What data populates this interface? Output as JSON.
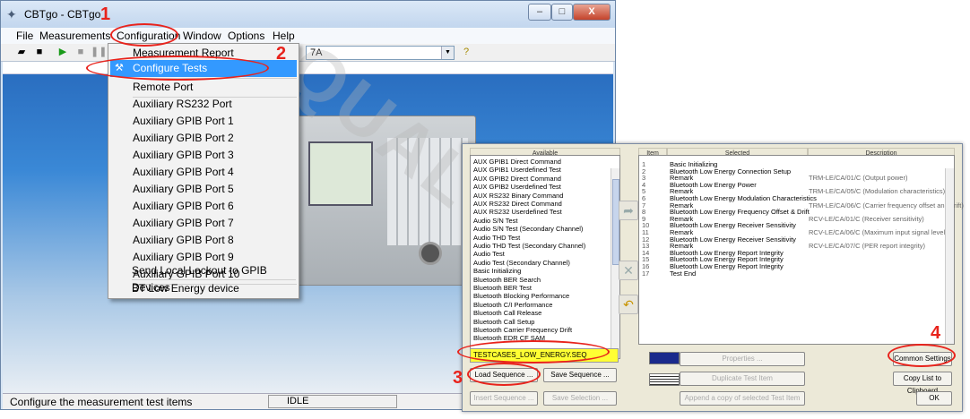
{
  "window": {
    "title": "CBTgo - CBTgo",
    "min": "–",
    "max": "□",
    "close": "X"
  },
  "menubar": [
    "File",
    "Measurements",
    "Configuration",
    "Window",
    "Options",
    "Help"
  ],
  "toolbar": {
    "combo_value": "7A"
  },
  "config_menu": {
    "items": [
      {
        "label": "Measurement Report"
      },
      {
        "label": "Configure Tests"
      },
      {
        "label": "Remote Port"
      },
      {
        "label": "Auxiliary RS232 Port"
      },
      {
        "label": "Auxiliary GPIB Port 1"
      },
      {
        "label": "Auxiliary GPIB Port 2"
      },
      {
        "label": "Auxiliary GPIB Port 3"
      },
      {
        "label": "Auxiliary GPIB Port 4"
      },
      {
        "label": "Auxiliary GPIB Port 5"
      },
      {
        "label": "Auxiliary GPIB Port 6"
      },
      {
        "label": "Auxiliary GPIB Port 7"
      },
      {
        "label": "Auxiliary GPIB Port 8"
      },
      {
        "label": "Auxiliary GPIB Port 9"
      },
      {
        "label": "Auxiliary GPIB Port 10"
      },
      {
        "label": "Send Local Lockout to GPIB Devices"
      },
      {
        "label": "BT Low Energy device"
      }
    ]
  },
  "statusbar": {
    "text": "Configure the measurement test items",
    "state": "IDLE"
  },
  "dialog": {
    "available_header": "Available",
    "available": [
      "AUX GPIB1 Direct Command",
      "AUX GPIB1 Userdefined Test",
      "AUX GPIB2 Direct Command",
      "AUX GPIB2 Userdefined Test",
      "AUX RS232 Binary Command",
      "AUX RS232 Direct Command",
      "AUX RS232 Userdefined Test",
      "Audio S/N Test",
      "Audio S/N Test (Secondary Channel)",
      "Audio THD Test",
      "Audio THD Test (Secondary Channel)",
      "Audio Test",
      "Audio Test (Secondary Channel)",
      "Basic Initializing",
      "Bluetooth BER Search",
      "Bluetooth BER Test",
      "Bluetooth Blocking Performance",
      "Bluetooth C/I Performance",
      "Bluetooth Call Release",
      "Bluetooth Call Setup",
      "Bluetooth Carrier Frequency Drift",
      "Bluetooth EDR CF SAM"
    ],
    "sequence_file": "TESTCASES_LOW_ENERGY.SEQ",
    "columns": {
      "item": "Item",
      "selected": "Selected",
      "description": "Description"
    },
    "rows": [
      {
        "n": "1",
        "name": "Basic Initializing",
        "desc": ""
      },
      {
        "n": "2",
        "name": "Bluetooth Low Energy Connection Setup",
        "desc": ""
      },
      {
        "n": "3",
        "name": "Remark",
        "desc": "TRM-LE/CA/01/C (Output power)"
      },
      {
        "n": "4",
        "name": "Bluetooth Low Energy Power",
        "desc": ""
      },
      {
        "n": "5",
        "name": "Remark",
        "desc": "TRM-LE/CA/05/C (Modulation characteristics)"
      },
      {
        "n": "6",
        "name": "Bluetooth Low Energy Modulation Characteristics",
        "desc": ""
      },
      {
        "n": "7",
        "name": "Remark",
        "desc": "TRM-LE/CA/06/C (Carrier frequency offset and drift)"
      },
      {
        "n": "8",
        "name": "Bluetooth Low Energy Frequency Offset & Drift",
        "desc": ""
      },
      {
        "n": "9",
        "name": "Remark",
        "desc": "RCV-LE/CA/01/C (Receiver sensitivity)"
      },
      {
        "n": "10",
        "name": "Bluetooth Low Energy Receiver Sensitivity",
        "desc": ""
      },
      {
        "n": "11",
        "name": "Remark",
        "desc": "RCV-LE/CA/06/C (Maximum input signal level)"
      },
      {
        "n": "12",
        "name": "Bluetooth Low Energy Receiver Sensitivity",
        "desc": ""
      },
      {
        "n": "13",
        "name": "Remark",
        "desc": "RCV-LE/CA/07/C (PER report integrity)"
      },
      {
        "n": "14",
        "name": "Bluetooth Low Energy Report Integrity",
        "desc": ""
      },
      {
        "n": "15",
        "name": "Bluetooth Low Energy Report Integrity",
        "desc": ""
      },
      {
        "n": "16",
        "name": "Bluetooth Low Energy Report Integrity",
        "desc": ""
      },
      {
        "n": "17",
        "name": "Test End",
        "desc": ""
      }
    ],
    "buttons": {
      "load_sequence": "Load Sequence ...",
      "save_sequence": "Save Sequence ...",
      "insert_sequence": "Insert Sequence ...",
      "save_selection": "Save Selection ...",
      "properties": "Properties ...",
      "duplicate": "Duplicate Test Item",
      "append_copy": "Append a copy of selected Test Item",
      "common_settings": "Common Settings ...",
      "copy_list": "Copy List to Clipboard",
      "ok": "OK"
    }
  },
  "annotations": [
    "1",
    "2",
    "3",
    "4"
  ],
  "colors": {
    "highlight": "#3399ff",
    "annotation": "#e8231c",
    "sequence_field": "#ffff33"
  }
}
